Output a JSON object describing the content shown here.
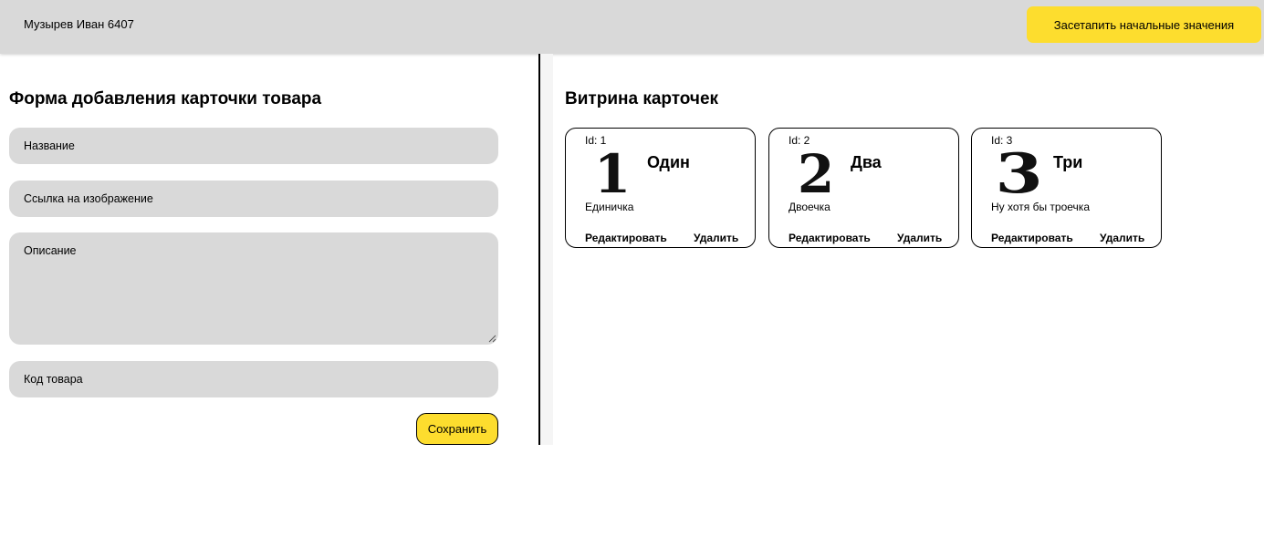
{
  "header": {
    "author": "Музырев Иван 6407",
    "reset_button": "Засетапить начальные значения"
  },
  "form": {
    "title": "Форма добавления карточки товара",
    "name_placeholder": "Название",
    "image_placeholder": "Ссылка на изображение",
    "description_placeholder": "Описание",
    "code_placeholder": "Код товара",
    "save_button": "Сохранить"
  },
  "showcase": {
    "title": "Витрина карточек",
    "cards": [
      {
        "id_label": "Id: 1",
        "image_glyph": "1",
        "name": "Один",
        "description": "Единичка",
        "edit": "Редактировать",
        "delete": "Удалить"
      },
      {
        "id_label": "Id: 2",
        "image_glyph": "2",
        "name": "Два",
        "description": "Двоечка",
        "edit": "Редактировать",
        "delete": "Удалить"
      },
      {
        "id_label": "Id: 3",
        "image_glyph": "3",
        "name": "Три",
        "description": "Ну хотя бы троечка",
        "edit": "Редактировать",
        "delete": "Удалить"
      }
    ]
  },
  "colors": {
    "accent_yellow": "#fddd2e",
    "field_gray": "#d9d9d9",
    "header_gray": "#d9d9d9"
  }
}
